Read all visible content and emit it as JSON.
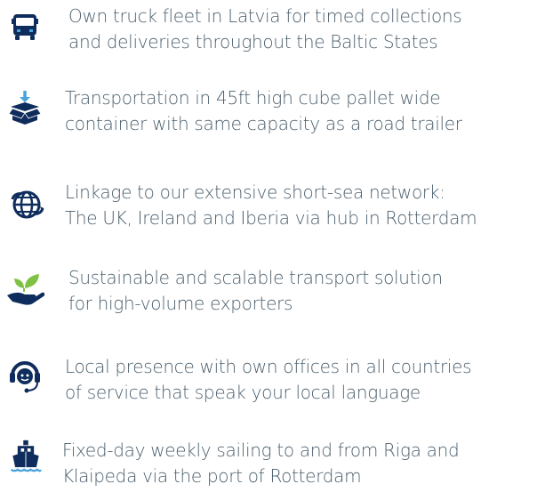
{
  "features": [
    {
      "icon": "truck-icon",
      "line1": "Own truck fleet in Latvia for timed collections",
      "line2": "and deliveries throughout the Baltic States"
    },
    {
      "icon": "box-download-icon",
      "line1": "Transportation in 45ft high cube pallet wide",
      "line2": "container with same capacity as a road trailer"
    },
    {
      "icon": "globe-network-icon",
      "line1": "Linkage to our extensive short-sea network:",
      "line2": "The UK, Ireland and Iberia via hub in Rotterdam"
    },
    {
      "icon": "hand-plant-icon",
      "line1": "Sustainable and scalable transport solution",
      "line2": "for high-volume exporters"
    },
    {
      "icon": "headset-person-icon",
      "line1": "Local presence with own offices in all countries",
      "line2": "of service that speak your local language"
    },
    {
      "icon": "ship-icon",
      "line1": "Fixed-day weekly sailing to and from Riga and",
      "line2": "Klaipeda via the port of Rotterdam"
    }
  ],
  "colors": {
    "icon_navy": "#0f2d5c",
    "icon_accent": "#4aa3df",
    "icon_green": "#7fc243",
    "text": "#4b5f6d"
  }
}
